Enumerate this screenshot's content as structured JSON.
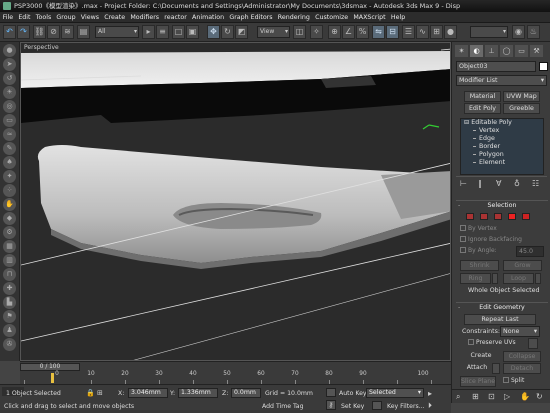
{
  "title": {
    "text": "PSP3000《模型渲染》.max  - Project Folder: C:\\Documents and Settings\\Administrator\\My Documents\\3dsmax   - Autodesk 3ds Max 9   - Disp"
  },
  "menu": [
    "File",
    "Edit",
    "Tools",
    "Group",
    "Views",
    "Create",
    "Modifiers",
    "reactor",
    "Animation",
    "Graph Editors",
    "Rendering",
    "Customize",
    "MAXScript",
    "Help"
  ],
  "toolbar": {
    "selection_filter": "All",
    "ref_coord": "View",
    "colors": {
      "accent": "#55aaff",
      "selected": "#5a6b7a"
    }
  },
  "left_tools": {
    "icons": [
      "sphere-icon",
      "arrow-icon",
      "orbit-icon",
      "light-icon",
      "camera-icon",
      "rect-icon",
      "wave-icon",
      "brush-icon",
      "teapot-icon",
      "bone-icon",
      "dots-icon",
      "hand-icon",
      "paint-icon",
      "gear-icon",
      "grid-icon",
      "cloth-icon",
      "pipe-icon",
      "plus-icon",
      "chart-icon",
      "flag-icon",
      "figure-icon",
      "wrench-icon"
    ]
  },
  "viewport": {
    "label": "Perspective",
    "background": "#2b2b2b",
    "model_color": "#c8c8c8"
  },
  "command_panel": {
    "tabs": [
      "create-tab",
      "modify-tab",
      "hierarchy-tab",
      "motion-tab",
      "display-tab",
      "utilities-tab"
    ],
    "object_name": "Object03",
    "object_color": "#ffffff",
    "modifier_list": "Modifier List",
    "buttons": [
      "Material",
      "UVW Map",
      "Edit Poly",
      "Greeble"
    ],
    "stack": {
      "root": "Editable Poly",
      "subobjects": [
        "Vertex",
        "Edge",
        "Border",
        "Polygon",
        "Element"
      ]
    },
    "selection": {
      "header": "Selection",
      "by_vertex": "By Vertex",
      "ignore_backfacing": "Ignore Backfacing",
      "by_angle": "By Angle:",
      "angle_value": "45.0",
      "shrink": "Shrink",
      "grow": "Grow",
      "ring": "Ring",
      "loop": "Loop",
      "status": "Whole Object Selected"
    },
    "edit_geometry": {
      "header": "Edit Geometry",
      "repeat_last": "Repeat Last",
      "constraints_label": "Constraints:",
      "constraints_value": "None",
      "preserve_uvs": "Preserve UVs",
      "create": "Create",
      "collapse": "Collapse",
      "attach": "Attach",
      "detach": "Detach",
      "slice_plane": "Slice Plane",
      "split": "Split"
    }
  },
  "timeline": {
    "slider": "0 / 100",
    "ticks": [
      "0",
      "10",
      "20",
      "30",
      "40",
      "50",
      "60",
      "70",
      "80",
      "90",
      "100"
    ]
  },
  "status": {
    "selected": "1 Object Selected",
    "prompt": "Click and drag to select and move objects",
    "x_label": "X:",
    "x": "3.046mm",
    "y_label": "Y:",
    "y": "1.336mm",
    "z_label": "Z:",
    "z": "0.0mm",
    "grid": "Grid = 10.0mm",
    "add_time_tag": "Add Time Tag",
    "auto_key": "Auto Key",
    "selected_dropdown": "Selected",
    "set_key": "Set Key",
    "key_filters": "Key Filters..."
  }
}
